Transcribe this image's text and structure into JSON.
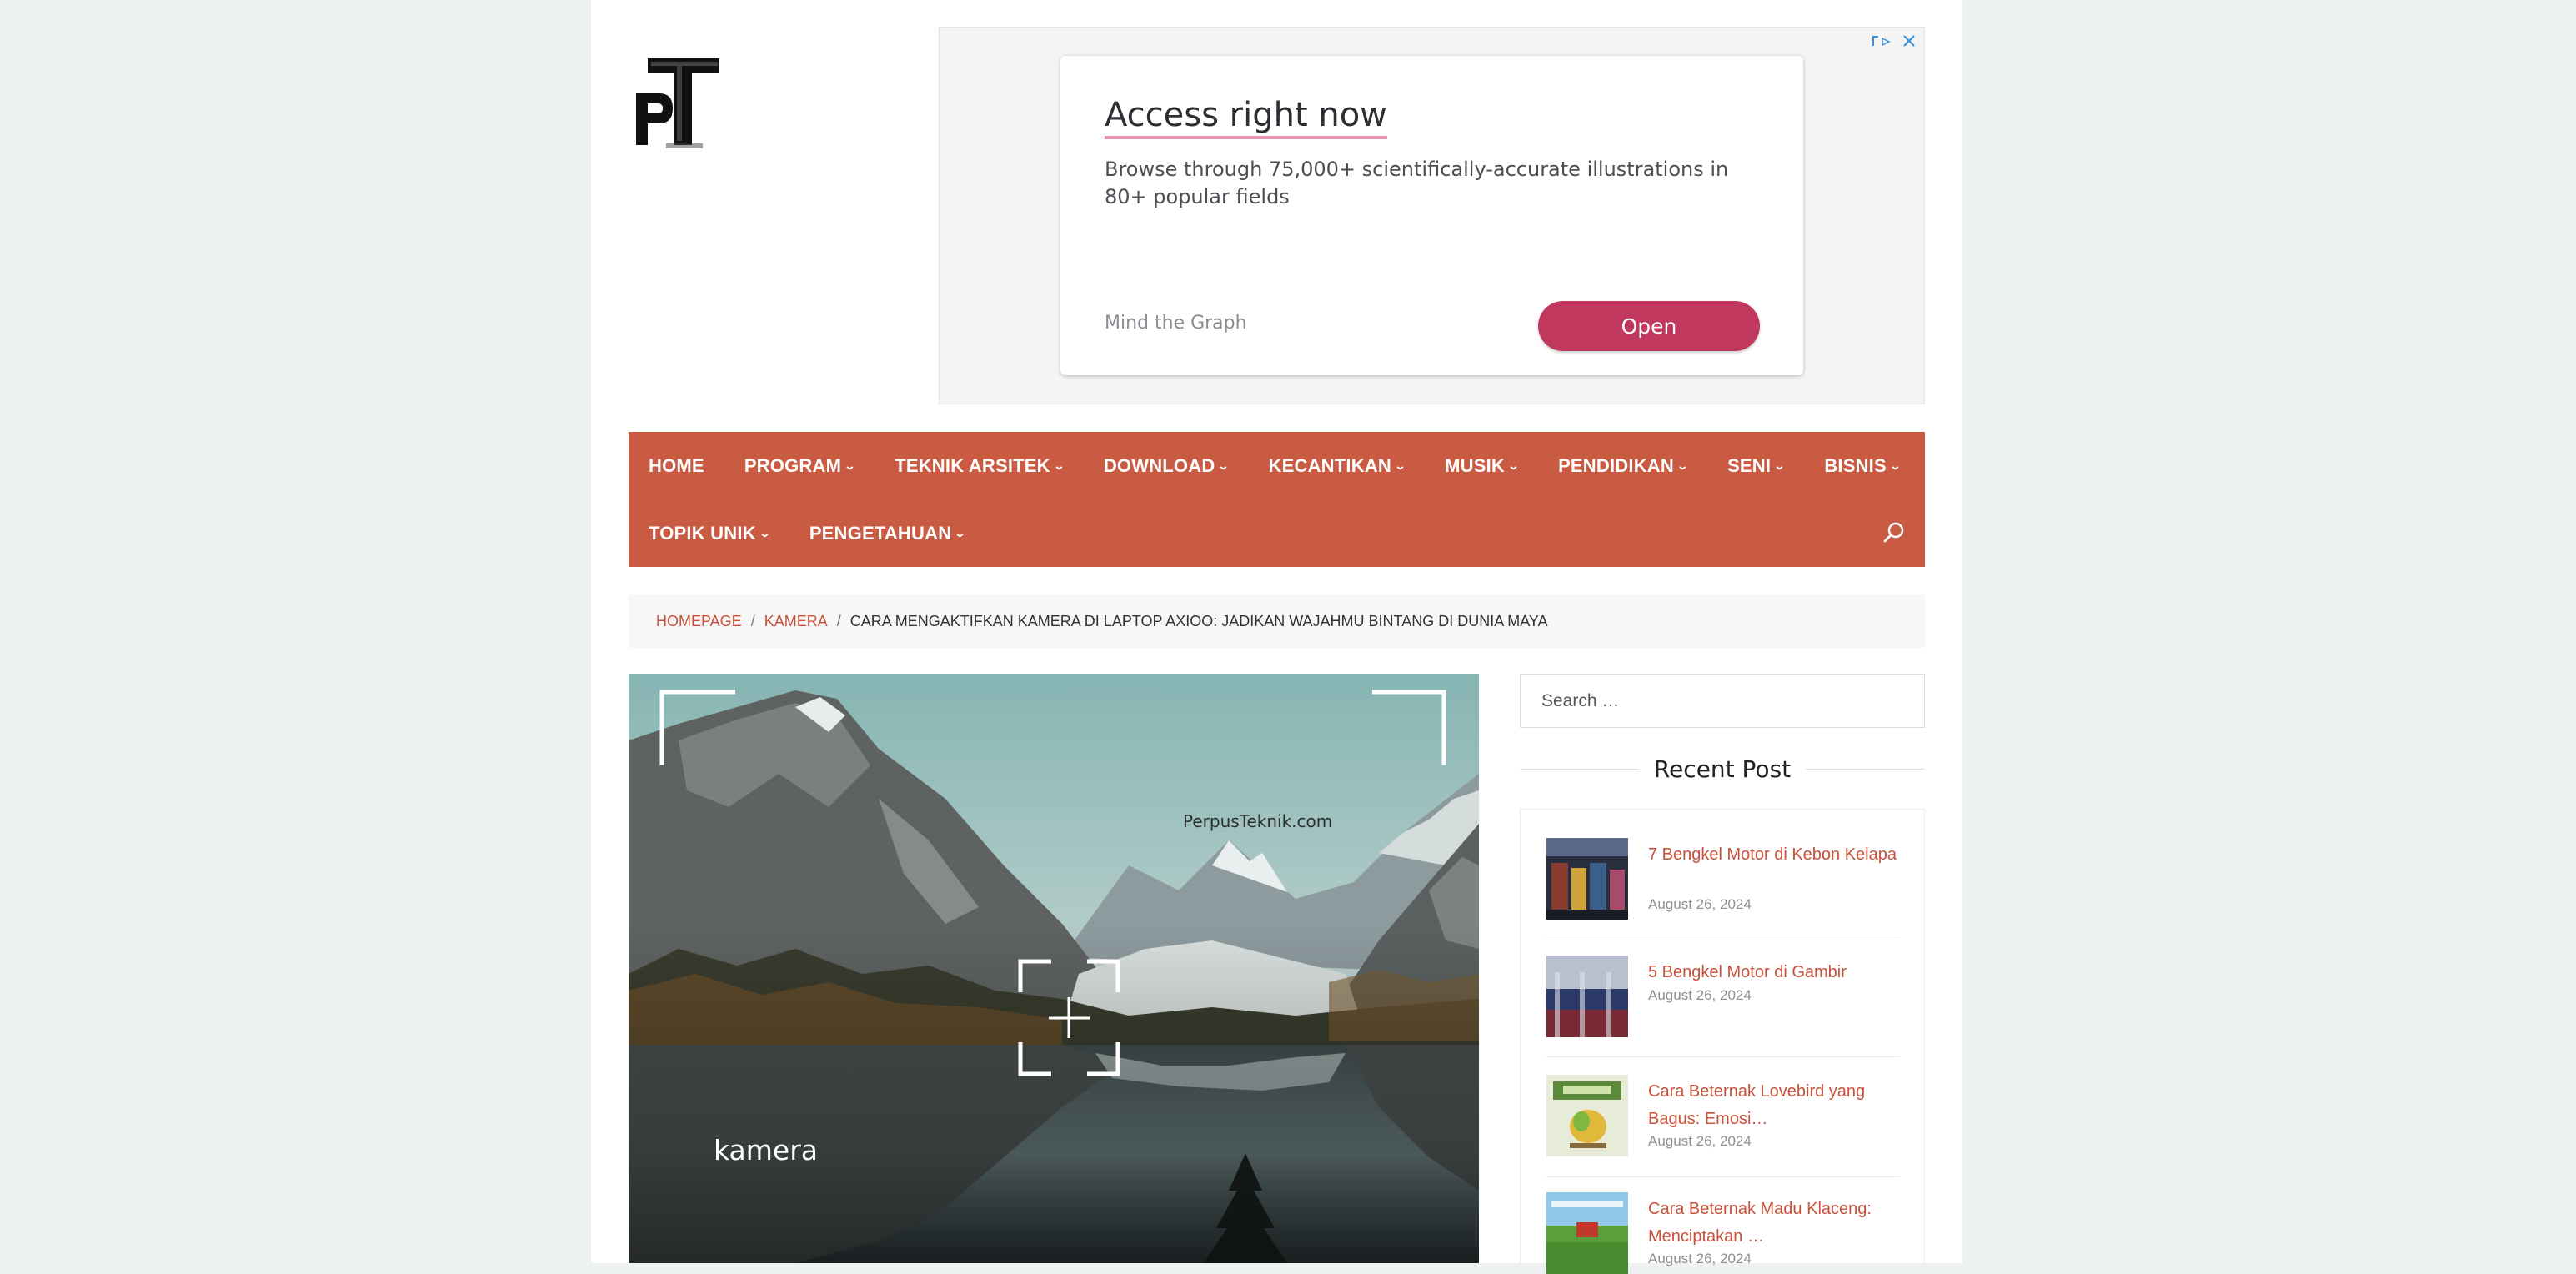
{
  "ad": {
    "title": "Access right now",
    "description": "Browse through 75,000+ scientifically-accurate illustrations in 80+ popular fields",
    "brand": "Mind the Graph",
    "cta": "Open"
  },
  "nav": {
    "row1": [
      {
        "label": "HOME",
        "dropdown": false
      },
      {
        "label": "PROGRAM",
        "dropdown": true
      },
      {
        "label": "TEKNIK ARSITEK",
        "dropdown": true
      },
      {
        "label": "DOWNLOAD",
        "dropdown": true
      },
      {
        "label": "KECANTIKAN",
        "dropdown": true
      },
      {
        "label": "MUSIK",
        "dropdown": true
      },
      {
        "label": "PENDIDIKAN",
        "dropdown": true
      },
      {
        "label": "SENI",
        "dropdown": true
      },
      {
        "label": "BISNIS",
        "dropdown": true
      }
    ],
    "row2": [
      {
        "label": "TOPIK UNIK",
        "dropdown": true
      },
      {
        "label": "PENGETAHUAN",
        "dropdown": true
      }
    ],
    "search_icon": "search-icon"
  },
  "breadcrumb": {
    "home": "HOMEPAGE",
    "category": "KAMERA",
    "separator": "/",
    "current": "CARA MENGAKTIFKAN KAMERA DI LAPTOP AXIOO: JADIKAN WAJAHMU BINTANG DI DUNIA MAYA"
  },
  "featured": {
    "watermark": "PerpusTeknik.com",
    "caption": "kamera"
  },
  "sidebar": {
    "search_placeholder": "Search …",
    "recent_title": "Recent Post",
    "posts": [
      {
        "title": "7 Bengkel Motor di Kebon Kelapa",
        "date": "August 26, 2024"
      },
      {
        "title": "5 Bengkel Motor di Gambir",
        "date": "August 26, 2024"
      },
      {
        "title": "Cara Beternak Lovebird yang Bagus: Emosi…",
        "date": "August 26, 2024"
      },
      {
        "title": "Cara Beternak Madu Klaceng: Menciptakan …",
        "date": "August 26, 2024"
      }
    ]
  },
  "colors": {
    "nav": "#ca5b43",
    "link": "#c9513a",
    "ad_button": "#c0385d",
    "background": "#edf1f2"
  }
}
